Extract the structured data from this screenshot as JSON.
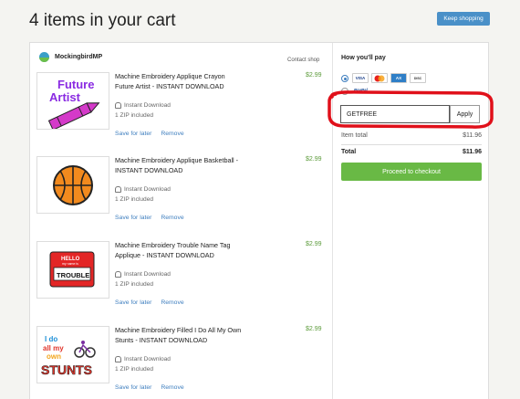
{
  "page": {
    "title": "4 items in your cart",
    "keep_shopping": "Keep shopping"
  },
  "shop": {
    "name": "MockingbirdMP",
    "contact": "Contact shop"
  },
  "items": [
    {
      "title": "Machine Embroidery Applique Crayon Future Artist - INSTANT DOWNLOAD",
      "download": "Instant Download",
      "zip": "1 ZIP included",
      "price": "$2.99",
      "save": "Save for later",
      "remove": "Remove",
      "thumb_text": [
        "Future",
        "Artist"
      ]
    },
    {
      "title": "Machine Embroidery Applique Basketball - INSTANT DOWNLOAD",
      "download": "Instant Download",
      "zip": "1 ZIP included",
      "price": "$2.99",
      "save": "Save for later",
      "remove": "Remove"
    },
    {
      "title": "Machine Embroidery Trouble Name Tag Applique - INSTANT DOWNLOAD",
      "download": "Instant Download",
      "zip": "1 ZIP included",
      "price": "$2.99",
      "save": "Save for later",
      "remove": "Remove",
      "thumb_text": [
        "HELLO",
        "my name is",
        "TROUBLE"
      ]
    },
    {
      "title": "Machine Embroidery Filled I Do All My Own Stunts - INSTANT DOWNLOAD",
      "download": "Instant Download",
      "zip": "1 ZIP included",
      "price": "$2.99",
      "save": "Save for later",
      "remove": "Remove",
      "thumb_text": [
        "I do",
        "all my",
        "own",
        "STUNTS"
      ]
    }
  ],
  "payment": {
    "heading": "How you'll pay",
    "cards": [
      "VISA",
      "MC",
      "AMEX",
      "DISCOVER"
    ],
    "paypal": "PayPal",
    "selected": "card",
    "coupon_value": "GETFREE",
    "apply_label": "Apply",
    "item_total_label": "Item total",
    "item_total": "$11.96",
    "total_label": "Total",
    "total": "$11.96",
    "checkout_label": "Proceed to checkout"
  },
  "colors": {
    "price": "#5b9b3a",
    "link": "#3f7fbf",
    "checkout": "#69b945",
    "keep_shopping": "#4a90c8",
    "highlight": "#e0101a"
  }
}
